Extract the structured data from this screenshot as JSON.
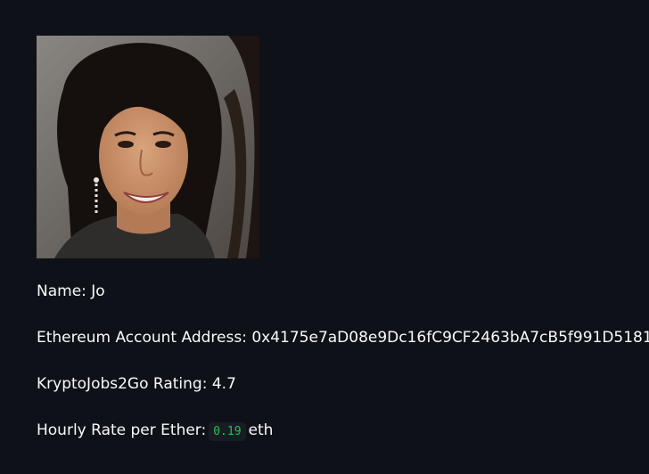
{
  "profile": {
    "photo_alt": "Profile photo",
    "name_label": "Name:",
    "name_value": "Jo",
    "address_label": "Ethereum Account Address:",
    "address_value": "0x4175e7aD08e9Dc16fC9CF2463bA7cB5f991D5181",
    "rating_label": "KryptoJobs2Go Rating:",
    "rating_value": "4.7",
    "rate_label": "Hourly Rate per Ether:",
    "rate_value": "0.19",
    "rate_unit": "eth"
  },
  "colors": {
    "background": "#0e1117",
    "text": "#fafafa",
    "code_text": "#21c354",
    "code_background": "#1a1c24"
  }
}
